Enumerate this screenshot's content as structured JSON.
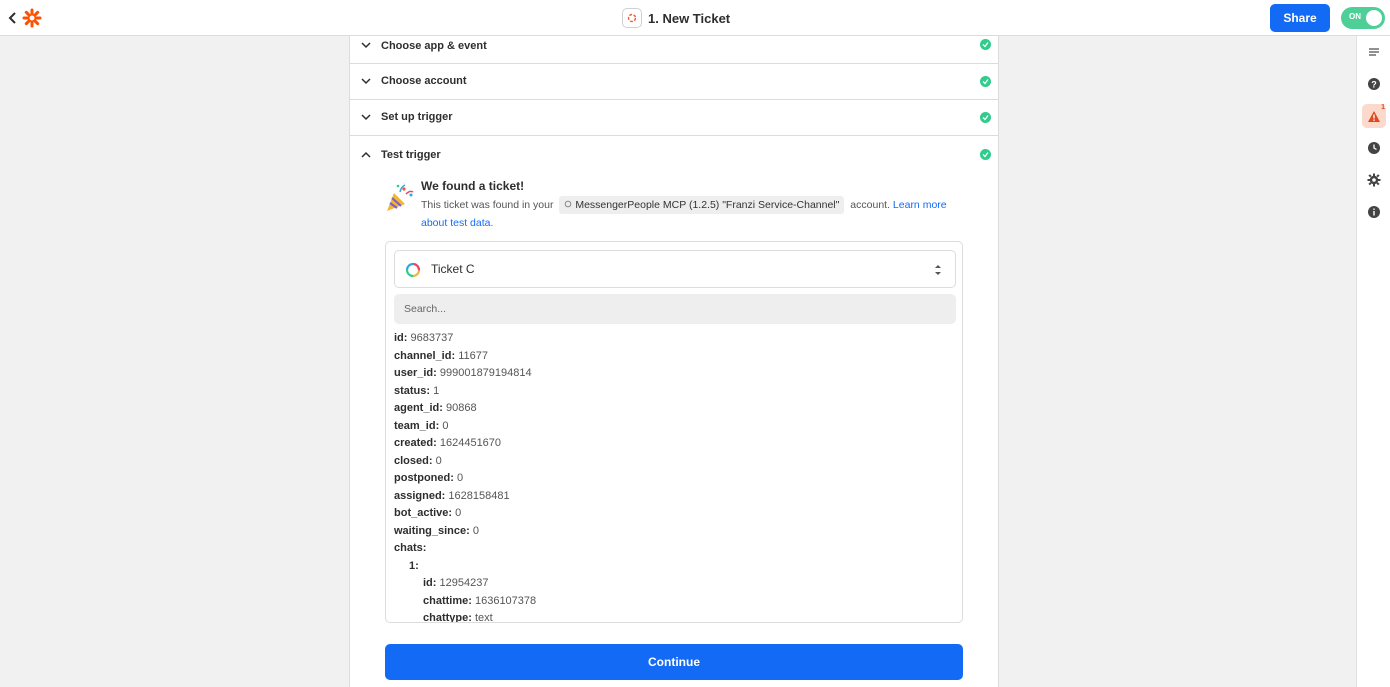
{
  "topbar": {
    "title": "1. New Ticket",
    "share_label": "Share",
    "toggle_label": "ON",
    "accent_color": "#136bf5",
    "toggle_color": "#4fcf98"
  },
  "steps": [
    {
      "label": "Choose app & event",
      "status": "complete"
    },
    {
      "label": "Choose account",
      "status": "complete"
    },
    {
      "label": "Set up trigger",
      "status": "complete"
    },
    {
      "label": "Test trigger",
      "status": "complete",
      "expanded": true
    }
  ],
  "test_result": {
    "title": "We found a ticket!",
    "desc_prefix": "This ticket was found in your",
    "account_name": "MessengerPeople MCP (1.2.5) \"Franzi Service-Channel\"",
    "desc_suffix": "account.",
    "link_text": "Learn more about test data."
  },
  "record": {
    "selected": "Ticket C",
    "search_placeholder": "Search..."
  },
  "fields": [
    {
      "k": "id:",
      "v": "9683737"
    },
    {
      "k": "channel_id:",
      "v": "11677"
    },
    {
      "k": "user_id:",
      "v": "999001879194814"
    },
    {
      "k": "status:",
      "v": "1"
    },
    {
      "k": "agent_id:",
      "v": "90868"
    },
    {
      "k": "team_id:",
      "v": "0"
    },
    {
      "k": "created:",
      "v": "1624451670"
    },
    {
      "k": "closed:",
      "v": "0"
    },
    {
      "k": "postponed:",
      "v": "0"
    },
    {
      "k": "assigned:",
      "v": "1628158481"
    },
    {
      "k": "bot_active:",
      "v": "0"
    },
    {
      "k": "waiting_since:",
      "v": "0"
    },
    {
      "k": "chats:",
      "v": ""
    },
    {
      "k": "1:",
      "v": ""
    },
    {
      "k": "id:",
      "v": "12954237"
    },
    {
      "k": "chattime:",
      "v": "1636107378"
    },
    {
      "k": "chattype:",
      "v": "text"
    }
  ],
  "continue_label": "Continue",
  "rail": {
    "icons": [
      "outline-icon",
      "help-icon",
      "alert-icon",
      "history-icon",
      "settings-icon",
      "info-icon"
    ],
    "alert_count": "1"
  }
}
